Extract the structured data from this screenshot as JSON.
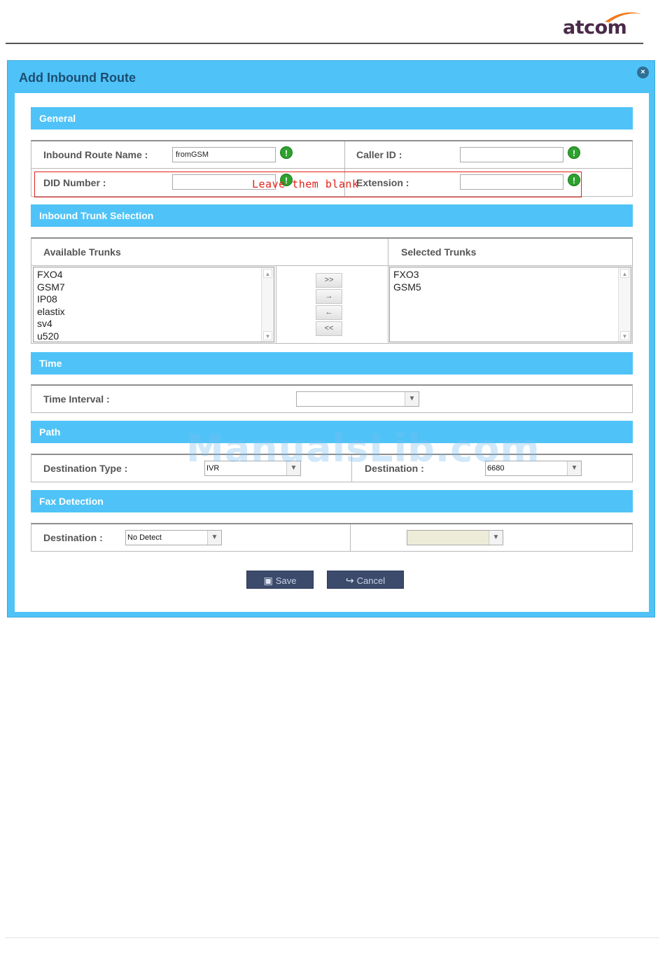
{
  "brand": {
    "logo_text": "atcom"
  },
  "dialog": {
    "title": "Add Inbound Route",
    "close_label": "×"
  },
  "general": {
    "section_label": "General",
    "inbound_route_name_label": "Inbound Route Name :",
    "inbound_route_name_value": "fromGSM",
    "caller_id_label": "Caller ID :",
    "caller_id_value": "",
    "did_number_label": "DID Number :",
    "did_number_value": "",
    "extension_label": "Extension :",
    "extension_value": "",
    "required_icon": "!"
  },
  "annotation": {
    "text": "Leave them blank",
    "color": "#e2231a"
  },
  "trunks": {
    "section_label": "Inbound Trunk Selection",
    "available_label": "Available Trunks",
    "selected_label": "Selected Trunks",
    "available": [
      "FXO4",
      "GSM7",
      "IP08",
      "elastix",
      "sv4",
      "u520"
    ],
    "selected": [
      "FXO3",
      "GSM5"
    ],
    "buttons": {
      "add_all": ">>",
      "add": "→",
      "remove": "←",
      "remove_all": "<<"
    }
  },
  "time": {
    "section_label": "Time",
    "interval_label": "Time Interval :",
    "interval_value": ""
  },
  "path": {
    "section_label": "Path",
    "destination_type_label": "Destination Type :",
    "destination_type_value": "IVR",
    "destination_label": "Destination :",
    "destination_value": "6680"
  },
  "fax": {
    "section_label": "Fax Detection",
    "destination_label": "Destination :",
    "destination_value": "No Detect",
    "secondary_value": ""
  },
  "actions": {
    "save_label": "Save",
    "cancel_label": "Cancel"
  },
  "watermark": {
    "text": "ManualsLib.com"
  },
  "colors": {
    "accent": "#4fc3f7",
    "title": "#1c4d73",
    "button": "#3c4a6b",
    "required": "#2ea12e"
  }
}
